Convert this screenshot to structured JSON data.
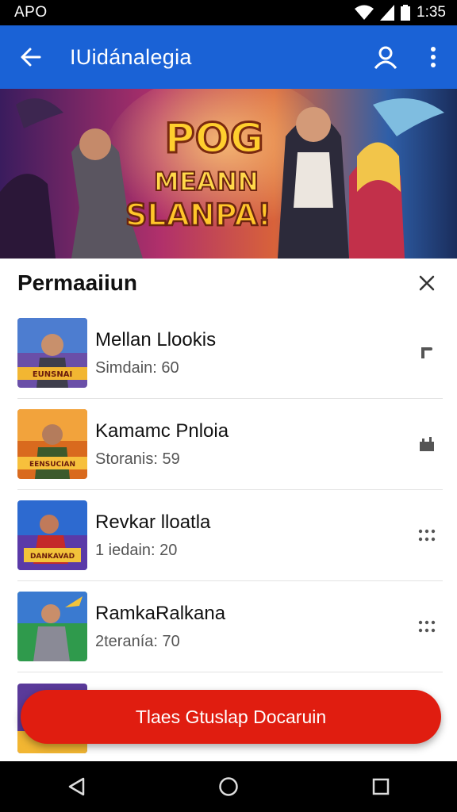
{
  "status_bar": {
    "carrier": "APO",
    "time": "1:35"
  },
  "app_bar": {
    "title": "IUidánalegia"
  },
  "banner": {
    "logo_line1": "POG",
    "logo_line2": "MEANN",
    "logo_line3": "SLANPA!"
  },
  "sheet": {
    "title": "Permaaiiun"
  },
  "list": [
    {
      "title": "Mellan Llookis",
      "subtitle": "Simdain: 60",
      "thumb_text": "EUNSNAI",
      "action_icon": "phone-handset-icon"
    },
    {
      "title": "Kamamc Pnloia",
      "subtitle": "Storanis: 59",
      "thumb_text": "EENSUCIAN",
      "action_icon": "castle-icon"
    },
    {
      "title": "Revkar lloatla",
      "subtitle": "1 iedain: 20",
      "thumb_text": "DANKAVAD",
      "action_icon": "grid-dots-icon"
    },
    {
      "title": "RamkaRalkana",
      "subtitle": "2teranía: 70",
      "thumb_text": "",
      "action_icon": "grid-dots-icon"
    },
    {
      "title": "",
      "subtitle": "",
      "thumb_text": "",
      "action_icon": ""
    }
  ],
  "cta": {
    "label": "Tlaes Gtuslap Docaruin"
  },
  "colors": {
    "app_bar": "#1a62d6",
    "cta": "#e01d10",
    "status_bar": "#000000"
  }
}
